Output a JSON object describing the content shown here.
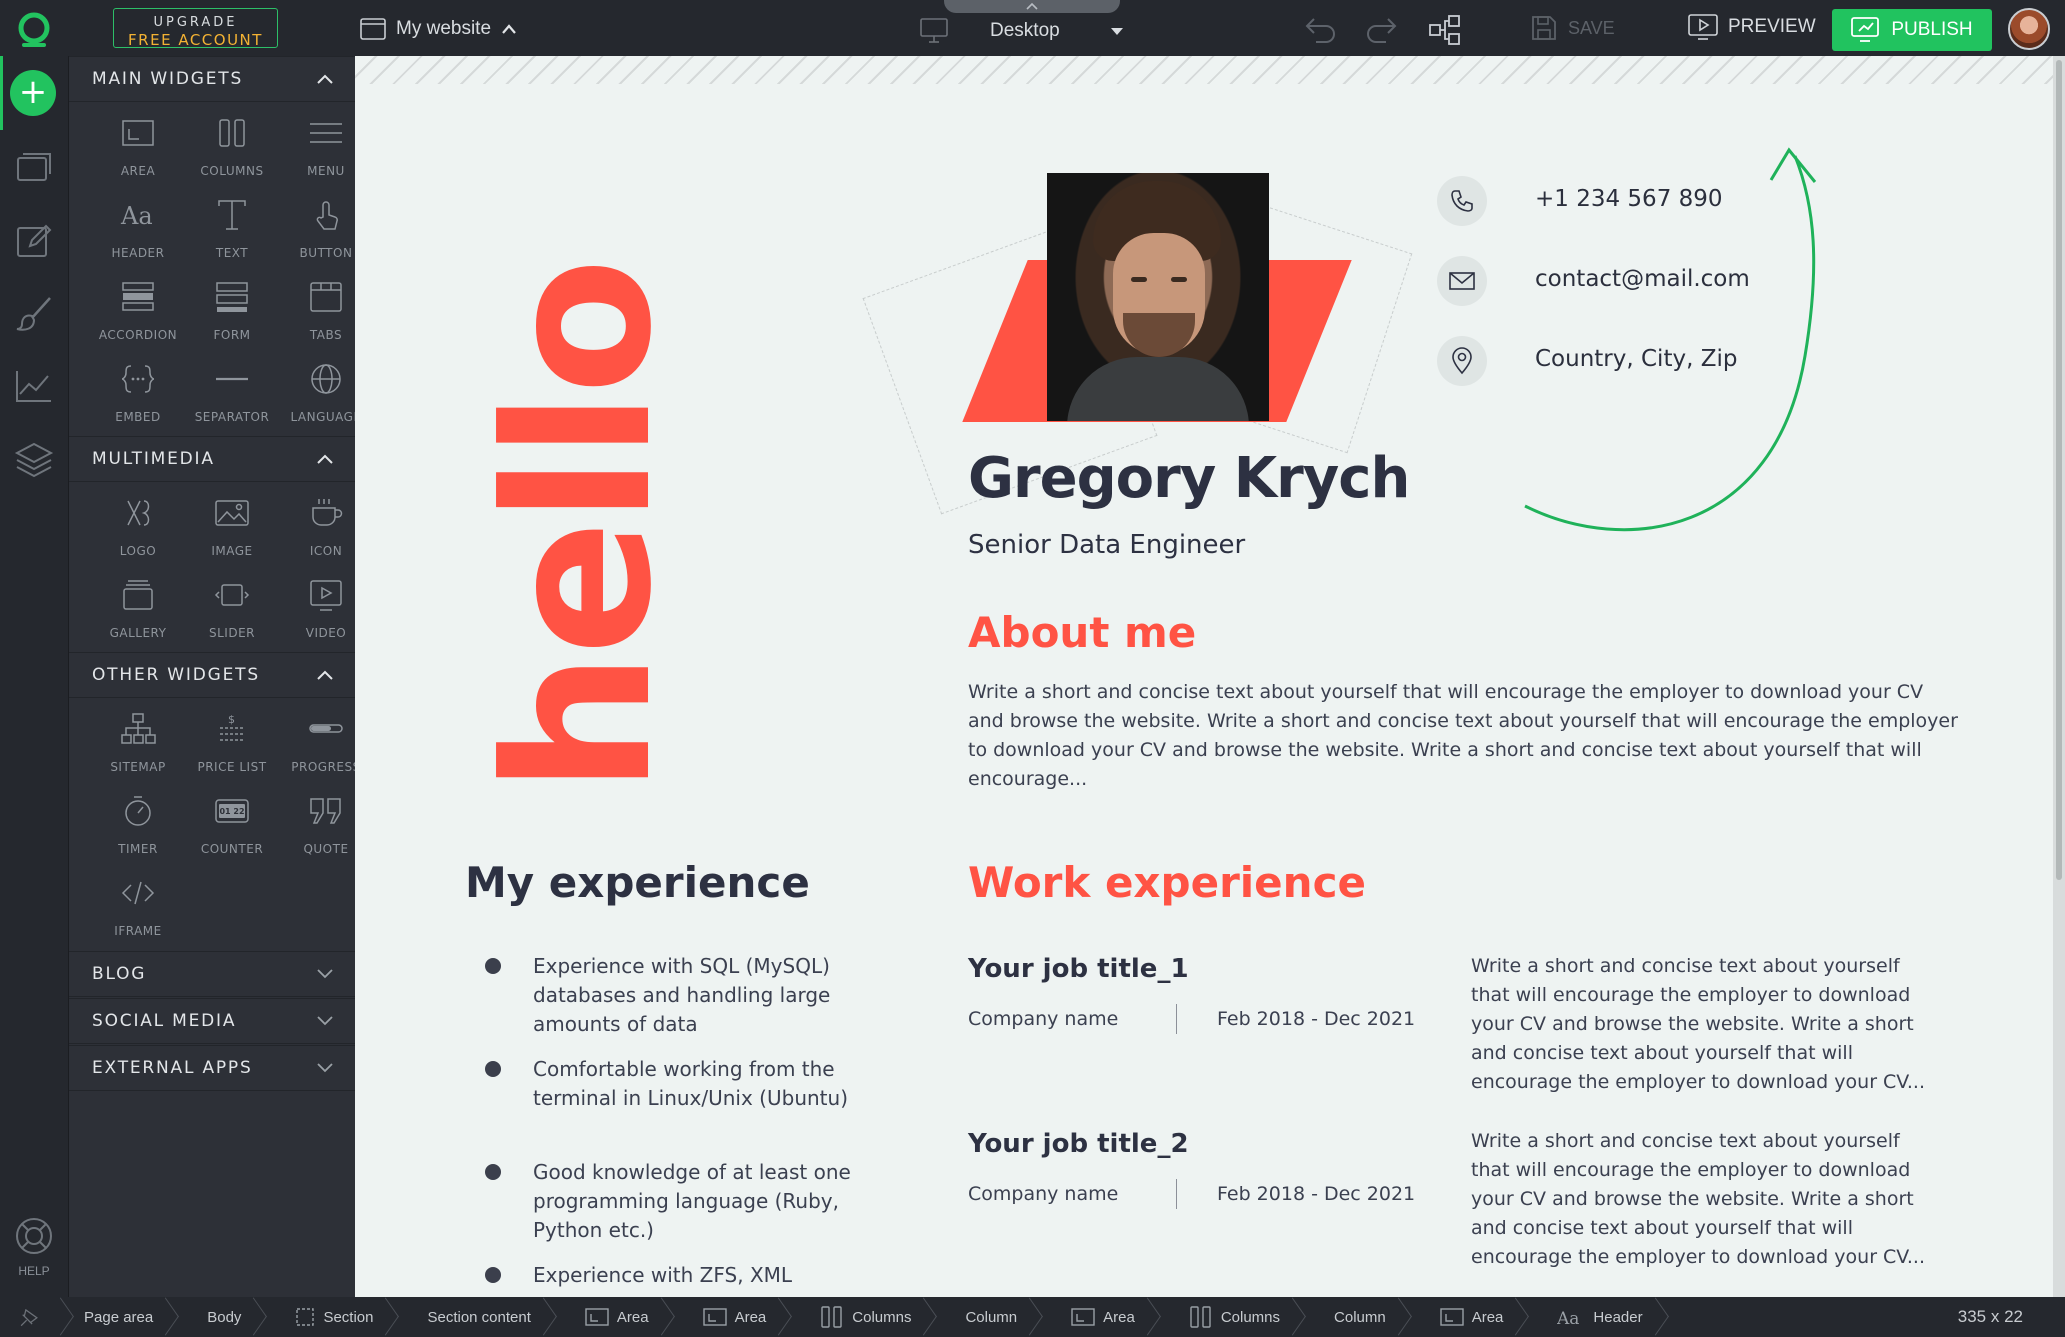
{
  "topbar": {
    "upgrade_line1": "UPGRADE",
    "upgrade_line2": "FREE ACCOUNT",
    "site_name": "My website",
    "device": "Desktop",
    "save_label": "SAVE",
    "preview_label": "PREVIEW",
    "publish_label": "PUBLISH"
  },
  "rail": {
    "help_label": "HELP"
  },
  "panel": {
    "main_widgets": {
      "title": "MAIN WIDGETS",
      "items": [
        "AREA",
        "COLUMNS",
        "MENU",
        "HEADER",
        "TEXT",
        "BUTTON",
        "ACCORDION",
        "FORM",
        "TABS",
        "EMBED",
        "SEPARATOR",
        "LANGUAGE"
      ]
    },
    "multimedia": {
      "title": "MULTIMEDIA",
      "items": [
        "LOGO",
        "IMAGE",
        "ICON",
        "GALLERY",
        "SLIDER",
        "VIDEO"
      ]
    },
    "other_widgets": {
      "title": "OTHER WIDGETS",
      "items": [
        "SITEMAP",
        "PRICE LIST",
        "PROGRESS",
        "TIMER",
        "COUNTER",
        "QUOTE",
        "IFRAME"
      ],
      "counter_icon_text": "01 22"
    },
    "collapsed": [
      "BLOG",
      "SOCIAL MEDIA",
      "EXTERNAL APPS"
    ]
  },
  "page": {
    "hello": "hello",
    "name": "Gregory Krych",
    "role": "Senior Data Engineer",
    "contacts": {
      "phone": "+1 234 567 890",
      "email": "contact@mail.com",
      "address": "Country, City, Zip"
    },
    "about_title": "About me",
    "about_text": "Write a short and concise text about yourself that will encourage the employer to download your CV and browse the website. Write a short and concise text about yourself that will encourage the employer to download your CV and browse the website. Write a short and concise text about yourself that will encourage...",
    "my_experience_title": "My experience",
    "my_experience": [
      "Experience with SQL (MySQL) databases and handling large amounts of data",
      "Comfortable working from the terminal in Linux/Unix (Ubuntu)",
      "Good knowledge of at least one programming language (Ruby, Python etc.)",
      "Experience with ZFS, XML"
    ],
    "work_experience_title": "Work experience",
    "jobs": [
      {
        "title": "Your job title_1",
        "company": "Company name",
        "dates": "Feb 2018 - Dec 2021",
        "text": "Write a short and concise text about yourself that will encourage the employer to download your CV and browse the website. Write a short and concise text about yourself that will encourage the employer to download your CV..."
      },
      {
        "title": "Your job title_2",
        "company": "Company name",
        "dates": "Feb 2018 - Dec 2021",
        "text": "Write a short and concise text about yourself that will encourage the employer to download your CV and browse the website. Write a short and concise text about yourself that will encourage the employer to download your CV..."
      }
    ]
  },
  "statusbar": {
    "crumbs": [
      "Page area",
      "Body",
      "Section",
      "Section content",
      "Area",
      "Area",
      "Columns",
      "Column",
      "Area",
      "Columns",
      "Column",
      "Area",
      "Header"
    ],
    "dimensions": "335 x 22"
  },
  "colors": {
    "accent_green": "#21c35f",
    "brand_red": "#ff5344",
    "dark_text": "#2d3142",
    "canvas_bg": "#eef3f2"
  }
}
